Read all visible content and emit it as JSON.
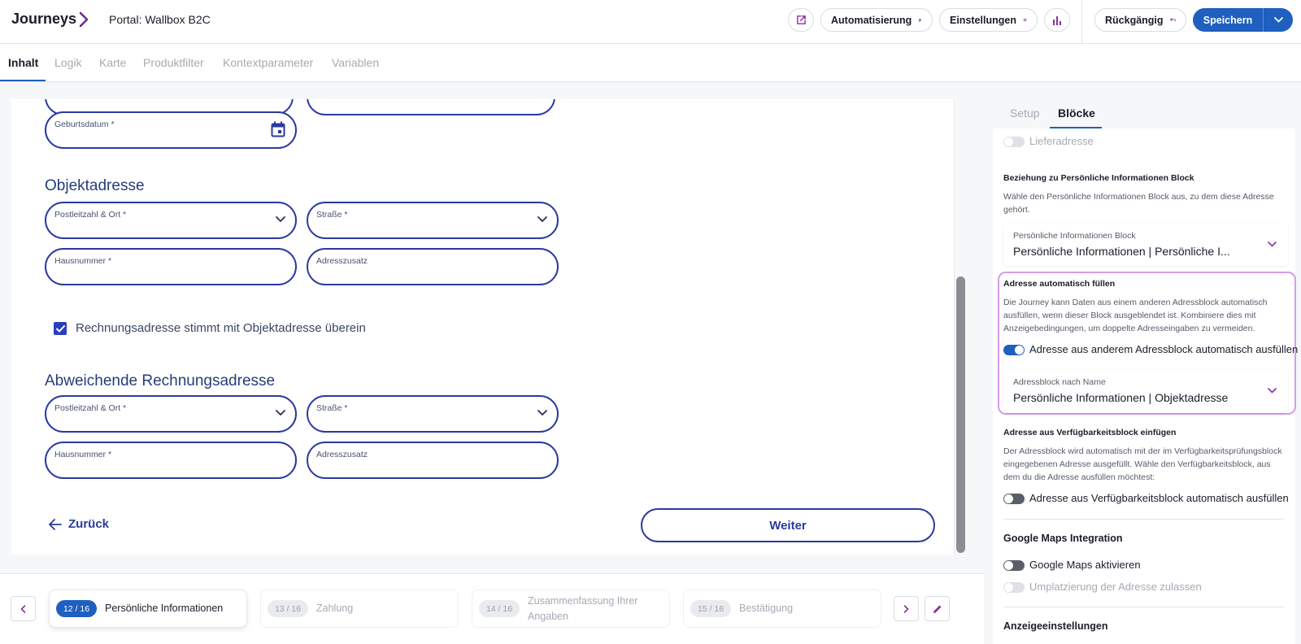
{
  "header": {
    "brand": "Journeys",
    "portal_title": "Portal: Wallbox B2C",
    "automation_label": "Automatisierung",
    "settings_label": "Einstellungen",
    "undo_label": "Rückgängig",
    "save_label": "Speichern"
  },
  "tabs": [
    "Inhalt",
    "Logik",
    "Karte",
    "Produktfilter",
    "Kontextparameter",
    "Variablen"
  ],
  "form": {
    "birthdate_label": "Geburtsdatum *",
    "object_section": "Objektadresse",
    "postal_label": "Postleitzahl & Ort *",
    "street_label": "Straße *",
    "house_label": "Hausnummer *",
    "addition_label": "Adresszusatz",
    "checkbox_label": "Rechnungsadresse stimmt mit Objektadresse überein",
    "billing_section": "Abweichende Rechnungsadresse",
    "back_label": "Zurück",
    "next_label": "Weiter"
  },
  "steps": [
    {
      "badge": "12 / 16",
      "label": "Persönliche Informationen"
    },
    {
      "badge": "13 / 16",
      "label": "Zahlung"
    },
    {
      "badge": "14 / 16",
      "label": "Zusammenfassung Ihrer Angaben"
    },
    {
      "badge": "15 / 16",
      "label": "Bestätigung"
    }
  ],
  "panel": {
    "tab_setup": "Setup",
    "tab_blocks": "Blöcke",
    "delivery_label": "Lieferadresse",
    "relation_heading": "Beziehung zu Persönliche Informationen Block",
    "relation_desc": "Wähle den Persönliche Informationen Block aus, zu dem diese Adresse gehört.",
    "relation_select_label": "Persönliche Informationen Block",
    "relation_select_value": "Persönliche Informationen | Persönliche I...",
    "autofill_heading": "Adresse automatisch füllen",
    "autofill_desc": "Die Journey kann Daten aus einem anderen Adressblock automatisch ausfüllen, wenn dieser Block ausgeblendet ist. Kombiniere dies mit Anzeigebedingungen, um doppelte Adresseingaben zu vermeiden.",
    "autofill_toggle_label": "Adresse aus anderem Adressblock automatisch ausfüllen",
    "autofill_select_label": "Adressblock nach Name",
    "autofill_select_value": "Persönliche Informationen | Objektadresse",
    "availability_heading": "Adresse aus Verfügbarkeitsblock einfügen",
    "availability_desc": "Der Adressblock wird automatisch mit der im Verfügbarkeitsprüfungsblock eingegebenen Adresse ausgefüllt. Wähle den Verfügbarkeitsblock, aus dem du die Adresse ausfüllen möchtest:",
    "availability_toggle_label": "Adresse aus Verfügbarkeitsblock automatisch ausfüllen",
    "maps_heading": "Google Maps Integration",
    "maps_toggle_label": "Google Maps aktivieren",
    "relocate_toggle_label": "Umplatzierung der Adresse zulassen",
    "display_heading": "Anzeigeeinstellungen"
  },
  "colors": {
    "primary": "#1f5fbf",
    "field_border": "#2a3aa0",
    "highlight": "#d49be8"
  }
}
